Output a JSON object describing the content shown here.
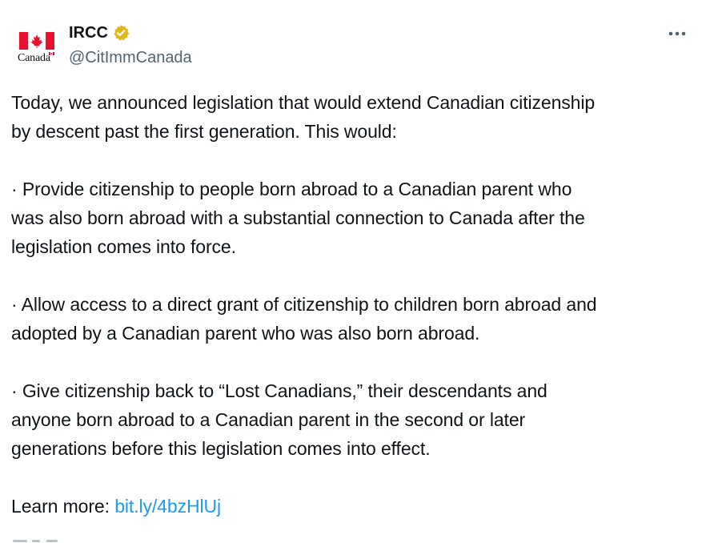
{
  "account": {
    "avatar_label": "Canada",
    "display_name": "IRCC",
    "handle": "@CitImmCanada",
    "verified_badge": "gold-check-icon"
  },
  "post": {
    "intro_line1": "Today, we announced legislation that would extend Canadian citizenship",
    "intro_line2": "by descent past the first generation. This would:",
    "bullet1_line1": "· Provide citizenship to people born abroad to a Canadian parent who",
    "bullet1_line2": "was also born abroad with a substantial connection to Canada after the",
    "bullet1_line3": "legislation comes into force.",
    "bullet2_line1": "· Allow access to a direct grant of citizenship to children born abroad and",
    "bullet2_line2": "adopted by a Canadian parent who was also born abroad.",
    "bullet3_line1": "· Give citizenship back to “Lost Canadians,” their descendants and",
    "bullet3_line2": "anyone born abroad to a Canadian parent in the second or later",
    "bullet3_line3": "generations before this legislation comes into effect.",
    "learn_more_label": "Learn more: ",
    "learn_more_link": "bit.ly/4bzHlUj"
  },
  "colors": {
    "text": "#0f1419",
    "secondary": "#536471",
    "link": "#1d9bf0",
    "flag_red": "#e8112d",
    "badge_gold": "#e2b719"
  },
  "icons": {
    "more": "more-horizontal-icon",
    "flag": "canada-flag-icon"
  }
}
